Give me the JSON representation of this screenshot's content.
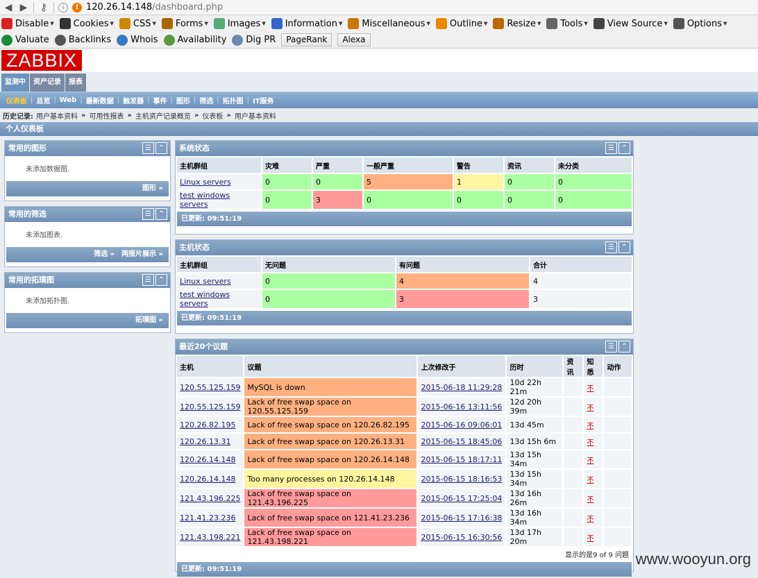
{
  "browser": {
    "url_host": "120.26.14.148",
    "url_path": "/dashboard.php"
  },
  "toolbar1": [
    {
      "label": "Disable",
      "icon": "disable-icon",
      "color": "#d22"
    },
    {
      "label": "Cookies",
      "icon": "cookies-icon",
      "color": "#333"
    },
    {
      "label": "CSS",
      "icon": "css-icon",
      "color": "#c80"
    },
    {
      "label": "Forms",
      "icon": "forms-icon",
      "color": "#a60"
    },
    {
      "label": "Images",
      "icon": "images-icon",
      "color": "#5a7"
    },
    {
      "label": "Information",
      "icon": "information-icon",
      "color": "#36c"
    },
    {
      "label": "Miscellaneous",
      "icon": "miscellaneous-icon",
      "color": "#c70"
    },
    {
      "label": "Outline",
      "icon": "outline-icon",
      "color": "#e80"
    },
    {
      "label": "Resize",
      "icon": "resize-icon",
      "color": "#b60"
    },
    {
      "label": "Tools",
      "icon": "tools-icon",
      "color": "#666"
    },
    {
      "label": "View Source",
      "icon": "view-source-icon",
      "color": "#444"
    },
    {
      "label": "Options",
      "icon": "options-icon",
      "color": "#555"
    }
  ],
  "toolbar2": [
    {
      "label": "Valuate",
      "icon": "valuate-icon",
      "color": "#1a8a3a"
    },
    {
      "label": "Backlinks",
      "icon": "backlinks-icon",
      "color": "#555"
    },
    {
      "label": "Whois",
      "icon": "whois-icon",
      "color": "#3a7ac0"
    },
    {
      "label": "Availability",
      "icon": "availability-icon",
      "color": "#5a9a3a"
    },
    {
      "label": "Dig PR",
      "icon": "dig-pr-icon",
      "color": "#6a8ab0"
    }
  ],
  "toolbar2_buttons": [
    "PageRank",
    "Alexa"
  ],
  "logo": "ZABBIX",
  "main_tabs": [
    "监测中",
    "资产记录",
    "报表"
  ],
  "sub_menu": [
    "仪表板",
    "总览",
    "Web",
    "最新数据",
    "触发器",
    "事件",
    "图形",
    "筛选",
    "拓扑图",
    "IT服务"
  ],
  "history": {
    "label": "历史记录:",
    "crumbs": [
      "用户基本资料",
      "可用性报表",
      "主机资产记录概览",
      "仪表板",
      "用户基本资料"
    ]
  },
  "page_title": "个人仪表板",
  "fav_graphs": {
    "title": "常用的图形",
    "empty": "未添加数据图.",
    "links": [
      "图形 »"
    ]
  },
  "fav_screens": {
    "title": "常用的筛选",
    "empty": "未添加图表.",
    "links": [
      "筛选 »",
      "两报片展示 »"
    ]
  },
  "fav_maps": {
    "title": "常用的拓璞图",
    "empty": "未添加拓扑图.",
    "links": [
      "拓璞图 »"
    ]
  },
  "system_status": {
    "title": "系统状态",
    "headers": [
      "主机群组",
      "灾难",
      "严重",
      "一般严重",
      "警告",
      "资讯",
      "未分类"
    ],
    "rows": [
      {
        "cells": [
          "Linux servers",
          "0",
          "0",
          "5",
          "1",
          "0",
          "0"
        ],
        "classes": [
          "lnk",
          "g",
          "g",
          "o",
          "y",
          "g",
          "g"
        ]
      },
      {
        "cells": [
          "test windows servers",
          "0",
          "3",
          "0",
          "0",
          "0",
          "0"
        ],
        "classes": [
          "lnk",
          "g",
          "r",
          "g",
          "g",
          "g",
          "g"
        ]
      }
    ],
    "updated": "已更新: 09:51:19"
  },
  "host_status": {
    "title": "主机状态",
    "headers": [
      "主机群组",
      "无问题",
      "有问题",
      "合计"
    ],
    "rows": [
      {
        "cells": [
          "Linux servers",
          "0",
          "4",
          "4"
        ],
        "classes": [
          "lnk",
          "g",
          "o",
          ""
        ]
      },
      {
        "cells": [
          "test windows servers",
          "0",
          "3",
          "3"
        ],
        "classes": [
          "lnk",
          "g",
          "r",
          ""
        ]
      }
    ],
    "updated": "已更新: 09:51:19"
  },
  "last_issues": {
    "title": "最近20个议题",
    "headers": [
      "主机",
      "议题",
      "上次修改于",
      "历时",
      "资讯",
      "知悉",
      "动作"
    ],
    "rows": [
      {
        "host": "120.55.125.159",
        "issue": "MySQL is down",
        "sev": "o",
        "changed": "2015-06-18 11:29:28",
        "age": "10d 22h 21m",
        "ack": "不"
      },
      {
        "host": "120.55.125.159",
        "issue": "Lack of free swap space on 120.55.125.159",
        "sev": "o",
        "changed": "2015-06-16 13:11:56",
        "age": "12d 20h 39m",
        "ack": "不"
      },
      {
        "host": "120.26.82.195",
        "issue": "Lack of free swap space on 120.26.82.195",
        "sev": "o",
        "changed": "2015-06-16 09:06:01",
        "age": "13d 45m",
        "ack": "不"
      },
      {
        "host": "120.26.13.31",
        "issue": "Lack of free swap space on 120.26.13.31",
        "sev": "o",
        "changed": "2015-06-15 18:45:06",
        "age": "13d 15h 6m",
        "ack": "不"
      },
      {
        "host": "120.26.14.148",
        "issue": "Lack of free swap space on 120.26.14.148",
        "sev": "o",
        "changed": "2015-06-15 18:17:11",
        "age": "13d 15h 34m",
        "ack": "不"
      },
      {
        "host": "120.26.14.148",
        "issue": "Too many processes on 120.26.14.148",
        "sev": "y",
        "changed": "2015-06-15 18:16:53",
        "age": "13d 15h 34m",
        "ack": "不"
      },
      {
        "host": "121.43.196.225",
        "issue": "Lack of free swap space on 121.43.196.225",
        "sev": "r",
        "changed": "2015-06-15 17:25:04",
        "age": "13d 16h 26m",
        "ack": "不"
      },
      {
        "host": "121.41.23.236",
        "issue": "Lack of free swap space on 121.41.23.236",
        "sev": "r",
        "changed": "2015-06-15 17:16:38",
        "age": "13d 16h 34m",
        "ack": "不"
      },
      {
        "host": "121.43.198.221",
        "issue": "Lack of free swap space on 121.43.198.221",
        "sev": "r",
        "changed": "2015-06-15 16:30:56",
        "age": "13d 17h 20m",
        "ack": "不"
      }
    ],
    "shown": "显示的是9 of 9 问题",
    "updated": "已更新: 09:51:19"
  },
  "watermark": "www.wooyun.org"
}
